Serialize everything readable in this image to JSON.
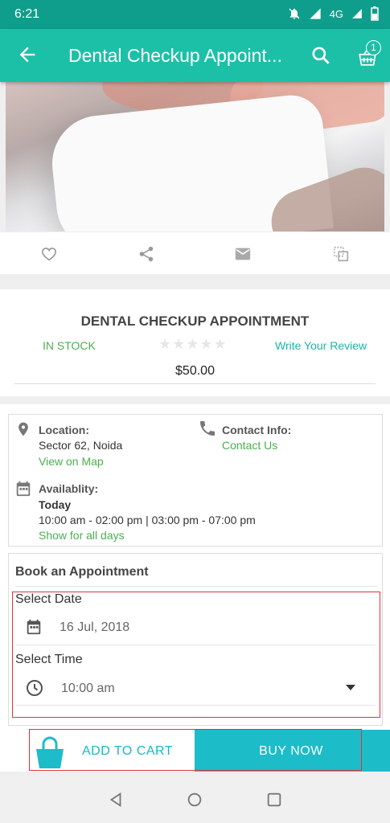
{
  "status_bar": {
    "time": "6:21",
    "network": "4G"
  },
  "app_bar": {
    "title": "Dental Checkup Appoint...",
    "cart_count": "1"
  },
  "product": {
    "name": "DENTAL CHECKUP APPOINTMENT",
    "stock": "IN STOCK",
    "rating_stars": "★★★★★",
    "review_link": "Write Your Review",
    "price": "$50.00"
  },
  "info": {
    "location_label": "Location:",
    "location_value": "Sector 62, Noida",
    "map_link": "View on Map",
    "contact_label": "Contact Info:",
    "contact_link": "Contact Us",
    "availability_label": "Availablity:",
    "availability_day": "Today",
    "availability_hours": "10:00 am - 02:00 pm | 03:00 pm - 07:00 pm",
    "all_days_link": "Show for all days"
  },
  "booking": {
    "title": "Book an Appointment",
    "date_label": "Select Date",
    "date_value": "16 Jul, 2018",
    "time_label": "Select Time",
    "time_value": "10:00 am"
  },
  "actions": {
    "add_to_cart": "ADD TO CART",
    "buy_now": "BUY NOW"
  },
  "colors": {
    "primary": "#1cc0a7",
    "status_bar": "#0e9e8b",
    "link_green": "#4caf50",
    "buy_now": "#1cbcc8"
  }
}
